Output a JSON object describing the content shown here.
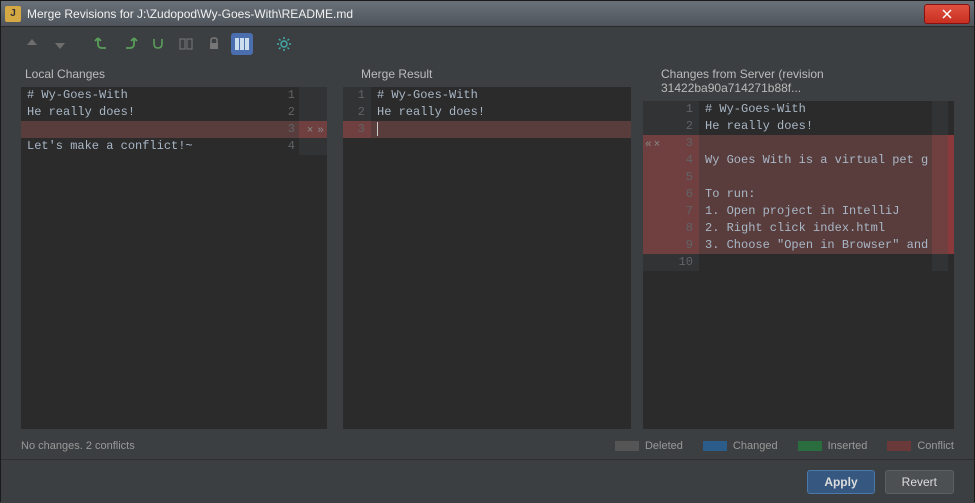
{
  "title": "Merge Revisions for J:\\Zudopod\\Wy-Goes-With\\README.md",
  "toolbar": {
    "icons": [
      "arrow-up",
      "arrow-down",
      "diff-prev",
      "diff-next",
      "diff-all",
      "diff-words",
      "lock",
      "columns",
      "gear"
    ]
  },
  "left": {
    "title": "Local Changes",
    "lines": [
      {
        "n": 1,
        "text": "# Wy-Goes-With",
        "cls": ""
      },
      {
        "n": 2,
        "text": "He really does!",
        "cls": ""
      },
      {
        "n": 3,
        "text": "",
        "cls": "conflict",
        "arrows": [
          "×",
          "»"
        ]
      },
      {
        "n": 4,
        "text": "Let's make a conflict!~",
        "cls": ""
      }
    ]
  },
  "mid": {
    "title": "Merge Result",
    "lines": [
      {
        "n": 1,
        "text": "# Wy-Goes-With",
        "cls": ""
      },
      {
        "n": 2,
        "text": "He really does!",
        "cls": ""
      },
      {
        "n": 3,
        "text": "",
        "cls": "conflict",
        "caret": true
      }
    ]
  },
  "right": {
    "title": "Changes from Server (revision 31422ba90a714271b88f...",
    "lines": [
      {
        "n": 1,
        "text": "# Wy-Goes-With",
        "cls": ""
      },
      {
        "n": 2,
        "text": "He really does!",
        "cls": ""
      },
      {
        "n": 3,
        "text": "",
        "cls": "conflict",
        "arrowsLeft": [
          "«",
          "×"
        ]
      },
      {
        "n": 4,
        "text": "Wy Goes With is a virtual pet g",
        "cls": "conflict"
      },
      {
        "n": 5,
        "text": "",
        "cls": "conflict"
      },
      {
        "n": 6,
        "text": "To run:",
        "cls": "conflict"
      },
      {
        "n": 7,
        "text": "1. Open project in IntelliJ",
        "cls": "conflict"
      },
      {
        "n": 8,
        "text": "2. Right click index.html",
        "cls": "conflict"
      },
      {
        "n": 9,
        "text": "3. Choose \"Open in Browser\" and",
        "cls": "conflict"
      },
      {
        "n": 10,
        "text": "",
        "cls": ""
      }
    ]
  },
  "status": "No changes. 2 conflicts",
  "legend": {
    "deleted": "Deleted",
    "changed": "Changed",
    "inserted": "Inserted",
    "conflict": "Conflict"
  },
  "buttons": {
    "apply": "Apply",
    "revert": "Revert"
  }
}
